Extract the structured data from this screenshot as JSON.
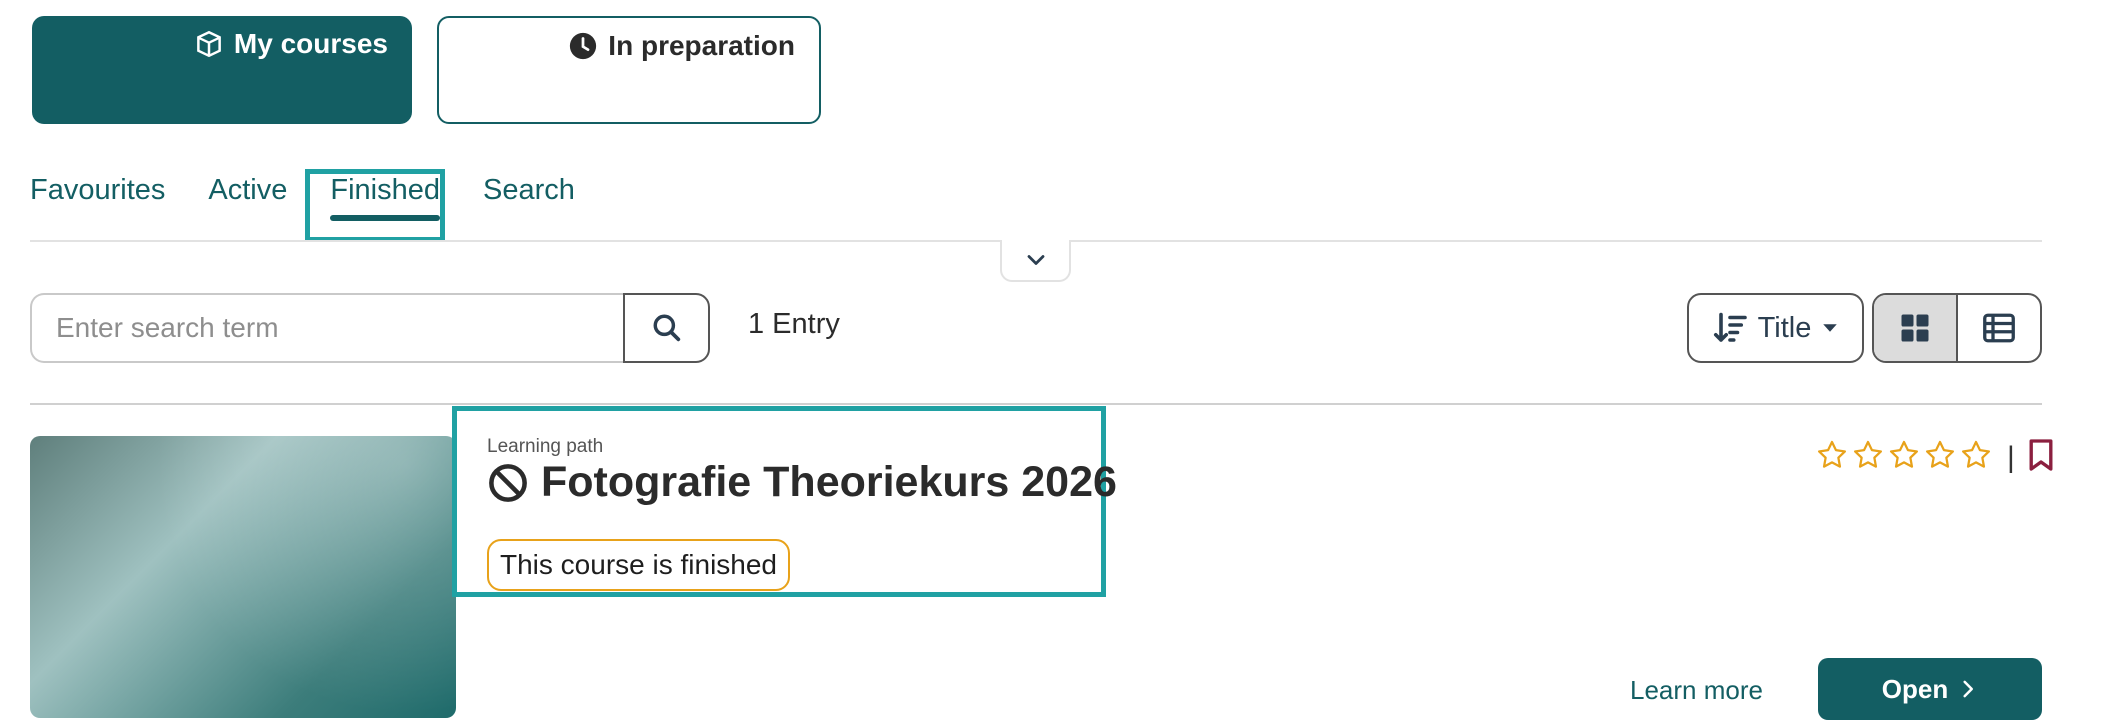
{
  "top_tabs": {
    "my_courses": {
      "label": "My courses",
      "icon": "cube-icon"
    },
    "in_preparation": {
      "label": "In preparation",
      "icon": "clock-icon"
    }
  },
  "subnav": {
    "items": [
      {
        "label": "Favourites",
        "active": false
      },
      {
        "label": "Active",
        "active": false
      },
      {
        "label": "Finished",
        "active": true
      },
      {
        "label": "Search",
        "active": false
      }
    ]
  },
  "search": {
    "placeholder": "Enter search term",
    "value": ""
  },
  "results": {
    "count_label": "1 Entry"
  },
  "sort": {
    "label": "Title"
  },
  "view_toggle": {
    "selected": "grid"
  },
  "card": {
    "type": "Learning path",
    "title": "Fotografie Theoriekurs 2026",
    "status_badge": "This course is finished",
    "rating_stars": 0,
    "rating_max": 5,
    "rating_separator": "|",
    "learn_more": "Learn more",
    "open": "Open"
  },
  "colors": {
    "brand": "#135e63",
    "focus": "#20a1a3",
    "badge_border": "#e8a21a",
    "star": "#e8a21a",
    "bookmark": "#8b1f3f"
  }
}
